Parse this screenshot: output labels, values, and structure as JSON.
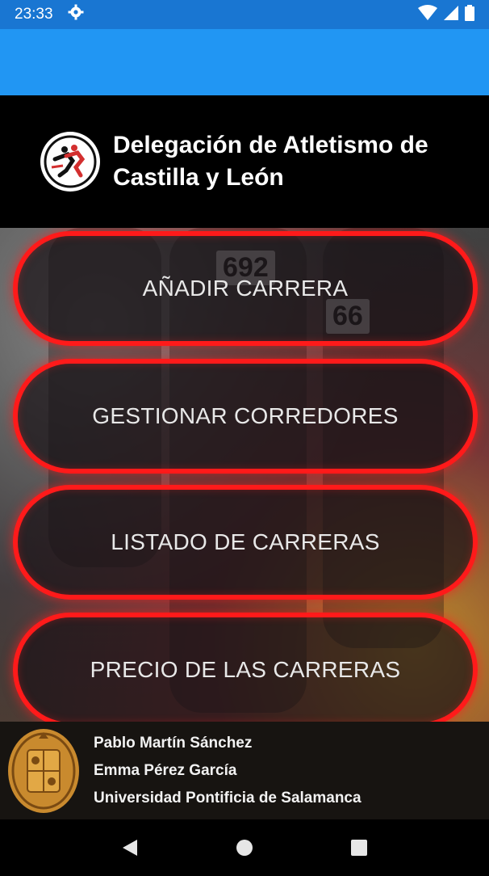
{
  "status_bar": {
    "time": "23:33",
    "icons": [
      "gear-icon",
      "wifi-icon",
      "signal-icon",
      "battery-icon"
    ]
  },
  "colors": {
    "status_bar": "#1976d2",
    "app_bar": "#2196f3",
    "button_border": "#ff1a1a",
    "header_bg": "#000000"
  },
  "header": {
    "title_line1": "Delegación de Atletismo de",
    "title_line2": "Castilla y León",
    "logo_icon": "runners-logo-icon"
  },
  "background": {
    "bibs": [
      "692",
      "66"
    ]
  },
  "menu": [
    {
      "label": "AÑADIR CARRERA"
    },
    {
      "label": "GESTIONAR CORREDORES"
    },
    {
      "label": "LISTADO DE CARRERAS"
    },
    {
      "label": "PRECIO DE LAS CARRERAS"
    }
  ],
  "footer": {
    "seal_icon": "university-seal-icon",
    "lines": [
      "Pablo Martín Sánchez",
      "Emma Pérez García",
      "Universidad Pontificia de Salamanca"
    ]
  },
  "nav_bar": {
    "icons": [
      "back-icon",
      "home-icon",
      "recents-icon"
    ]
  }
}
